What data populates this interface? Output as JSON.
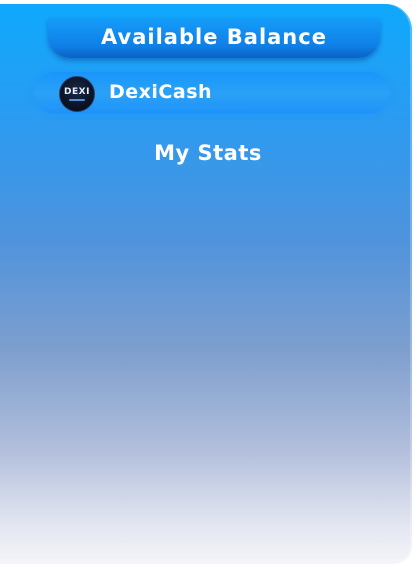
{
  "balance_panel": {
    "title": "Available Balance",
    "currency": {
      "name": "DexiCash",
      "logo_text": "DEXI"
    }
  },
  "stats": {
    "title": "My Stats"
  },
  "colors": {
    "panel_top": "#0ea9fd",
    "panel_bottom": "#f4f5f9",
    "title_bar": "#0f7fe6",
    "text": "#ffffff"
  },
  "icons": {
    "coin": "dexicash-logo-icon"
  }
}
